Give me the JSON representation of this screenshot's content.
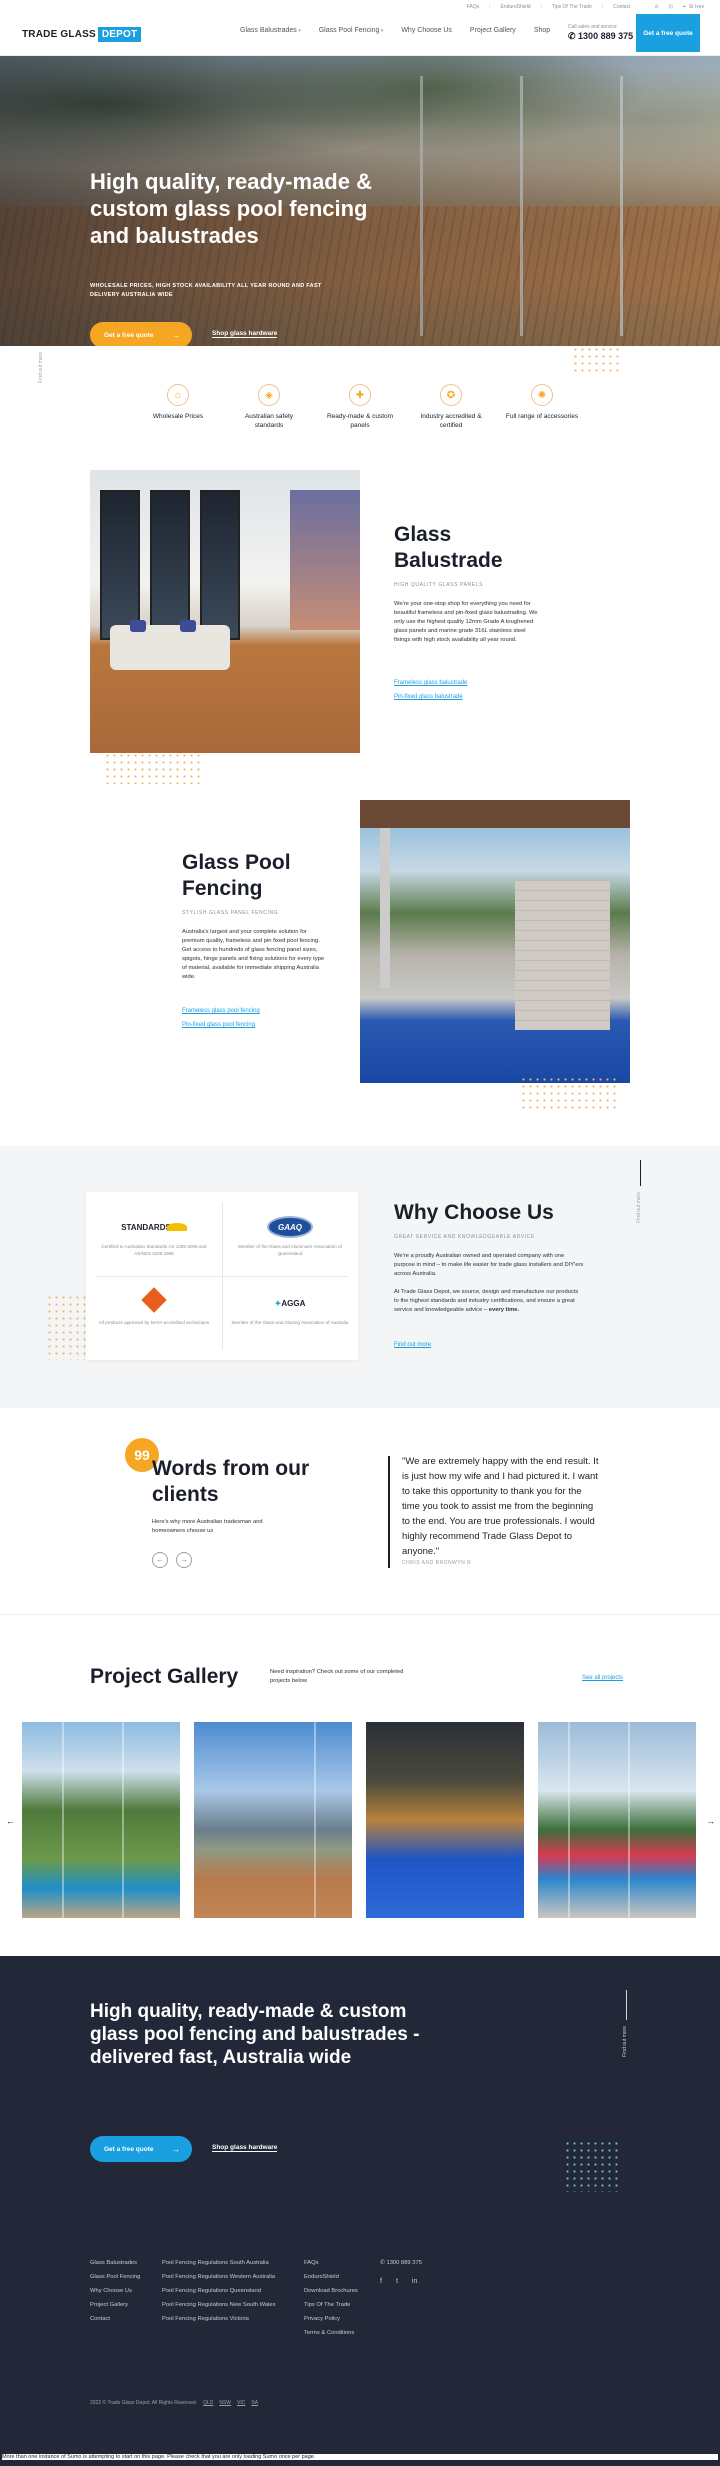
{
  "util": {
    "links": [
      "FAQs",
      "EnduroShield",
      "Tips Of The Trade",
      "Contact"
    ],
    "location": "St Ives"
  },
  "header": {
    "logo_part1": "TRADE GLASS",
    "logo_part2": "DEPOT",
    "nav": [
      "Glass Balustrades",
      "Glass Pool Fencing",
      "Why Choose Us",
      "Project Gallery",
      "Shop"
    ],
    "call_label": "Call sales and service",
    "phone": "1300 889 375",
    "quote_button": "Get a free quote"
  },
  "hero": {
    "title": "High quality, ready-made & custom glass pool fencing and balustrades",
    "subtitle": "WHOLESALE PRICES, HIGH STOCK AVAILABILITY ALL YEAR ROUND AND FAST DELIVERY AUSTRALIA WIDE",
    "cta_primary": "Get a free quote",
    "cta_secondary": "Shop glass hardware",
    "side_label": "Find out more"
  },
  "features": [
    {
      "label": "Wholesale Prices",
      "icon": "price-tag-icon"
    },
    {
      "label": "Australian safety standards",
      "icon": "shield-icon"
    },
    {
      "label": "Ready-made & custom panels",
      "icon": "tools-icon"
    },
    {
      "label": "Industry accredited & certified",
      "icon": "award-icon"
    },
    {
      "label": "Full range of accessories",
      "icon": "gear-icon"
    }
  ],
  "balustrade": {
    "title": "Glass Balustrade",
    "eyebrow": "HIGH QUALITY GLASS PANELS",
    "body": "We're your one-stop shop for everything you need for beautiful frameless and pin-fixed glass balustrading. We only use the highest quality 12mm Grade A toughened glass panels and marine grade 316L stainless steel fixings with high stock availability all year round.",
    "link1": "Frameless glass balustrade",
    "link2": "Pin-fixed glass balustrade"
  },
  "pool": {
    "title": "Glass Pool Fencing",
    "eyebrow": "STYLISH GLASS PANEL FENCING",
    "body": "Australia's largest and your complete solution for premium quality, frameless and pin fixed pool fencing. Get access to hundreds of glass fencing panel sizes, spigots, hinge panels and fixing solutions for every type of material, available for immediate shipping Australia wide.",
    "link1": "Frameless glass pool fencing",
    "link2": "Pin-fixed glass pool fencing"
  },
  "why": {
    "title": "Why Choose Us",
    "eyebrow": "GREAT SERVICE AND KNOWLEDGEABLE ADVICE",
    "body1": "We're a proudly Australian owned and operated company with one purpose in mind – to make life easier for trade glass installers and DIY'ers across Australia.",
    "body2": "At Trade Glass Depot, we source, design and manufacture our products to the highest standards and industry certifications, and ensure a great service and knowledgeable advice –",
    "body2_bold": "every time.",
    "link": "Find out more",
    "side_label": "Find out more",
    "certs": [
      {
        "logo": "STANDARDS",
        "caption": "Certified to Australian Standards AS 1288-2006 and AS/NZS 2208:1996"
      },
      {
        "logo": "GAAQ",
        "caption": "Member of the Glass and Aluminium Association of Queensland"
      },
      {
        "logo": "NATA",
        "caption": "All products approved by NATA-accredited technicians"
      },
      {
        "logo": "AGGA",
        "caption": "Member of the Glass and Glazing Association of Australia"
      }
    ]
  },
  "testimonial": {
    "badge": "99",
    "title": "Words from our clients",
    "sub": "Here's why more Australian tradesman and homeowners choose us",
    "quote": "\"We are extremely happy with the end result. It is just how my wife and I had pictured it. I want to take this opportunity to thank you for the time you took to assist me from the beginning to the end. You are true professionals. I would highly recommend Trade Glass Depot to anyone.\"",
    "author": "CHRIS AND BRONWYN R",
    "prev": "←",
    "next": "→"
  },
  "gallery": {
    "title": "Project Gallery",
    "intro": "Need inspiration? Check out some of our completed projects below",
    "link": "See all projects",
    "prev": "←",
    "next": "→"
  },
  "cta": {
    "title": "High quality, ready-made & custom glass pool fencing and balustrades - delivered fast, Australia wide",
    "primary": "Get a free quote",
    "secondary": "Shop glass hardware",
    "side_label": "Find out more"
  },
  "footer": {
    "col1": [
      "Glass Balustrades",
      "Glass Pool Fencing",
      "Why Choose Us",
      "Project Gallery",
      "Contact"
    ],
    "col2": [
      "Pool Fencing Regulations South Australia",
      "Pool Fencing Regulations Western Australia",
      "Pool Fencing Regulations Queensland",
      "Pool Fencing Regulations New South Wales",
      "Pool Fencing Regulations Victoria"
    ],
    "col3": [
      "FAQs",
      "EnduroShield",
      "Download Brochures",
      "Tips Of The Trade",
      "Privacy Policy",
      "Terms & Conditions"
    ],
    "phone": "1300 889 375",
    "social": [
      "f",
      "t",
      "in"
    ],
    "copyright": "2022 © Trade Glass Depot. All Rights Reserved.",
    "states": [
      "QLD",
      "NSW",
      "VIC",
      "SA"
    ]
  },
  "notice": "More than one instance of Sumo is attempting to start on this page. Please check that you are only loading Sumo once per page."
}
